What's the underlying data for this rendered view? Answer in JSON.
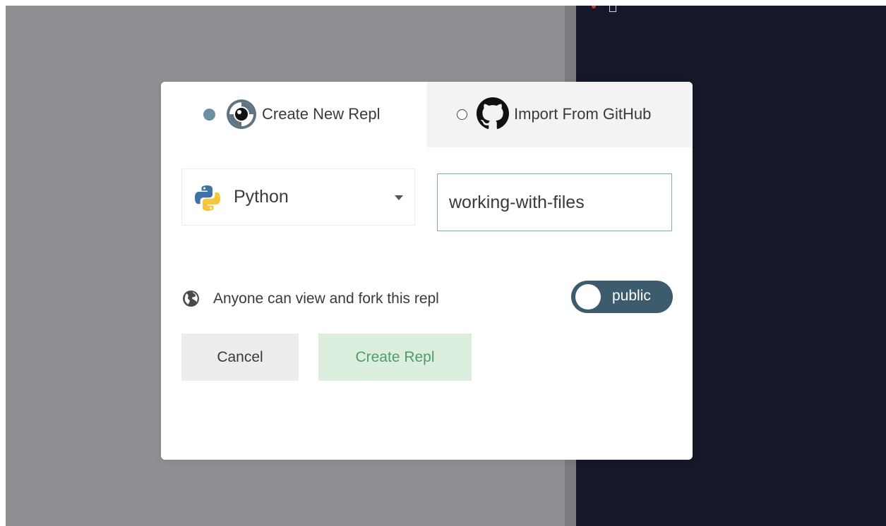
{
  "colors": {
    "overlay": "#8e8f93",
    "editor_bg": "#141829",
    "radio_active": "#6d8fa3",
    "toggle_bg": "#3c5c6d",
    "input_border": "#7ea9c1",
    "create_button_bg": "#dcefdf",
    "create_button_text": "#4f9c67",
    "cancel_button_bg": "#ededed"
  },
  "tabs": {
    "create": {
      "label": "Create New Repl",
      "icon": "replit-logo-icon",
      "selected": true
    },
    "import": {
      "label": "Import From GitHub",
      "icon": "github-logo-icon",
      "selected": false
    }
  },
  "form": {
    "language": {
      "value": "Python",
      "icon": "python-logo-icon"
    },
    "repl_name": {
      "value": "working-with-files"
    }
  },
  "privacy": {
    "text": "Anyone can view and fork this repl",
    "icon": "globe-icon",
    "toggle_label": "public"
  },
  "buttons": {
    "cancel": "Cancel",
    "create": "Create Repl"
  }
}
